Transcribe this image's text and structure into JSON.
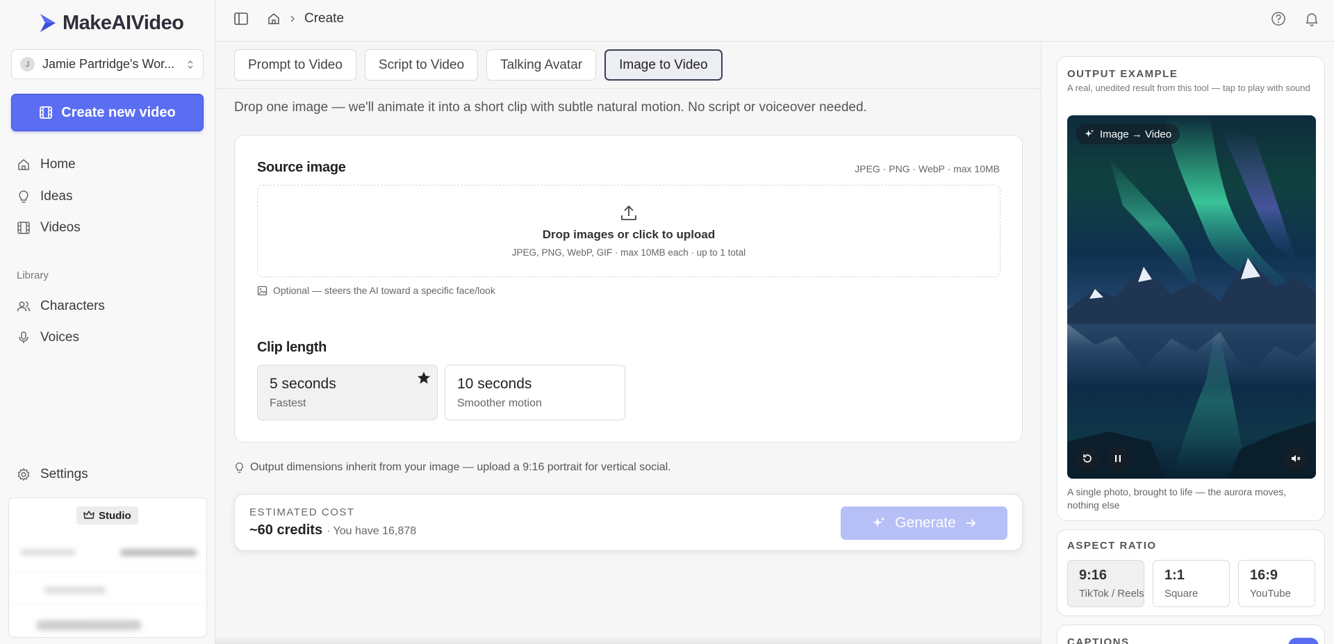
{
  "sidebar": {
    "logo_text": "MakeAIVideo",
    "workspace": {
      "initial": "J",
      "name": "Jamie Partridge's Wor..."
    },
    "create_button": "Create new video",
    "nav": [
      {
        "label": "Home",
        "icon": "home-icon"
      },
      {
        "label": "Ideas",
        "icon": "lightbulb-icon"
      },
      {
        "label": "Videos",
        "icon": "film-icon"
      }
    ],
    "library_label": "Library",
    "library": [
      {
        "label": "Characters",
        "icon": "users-icon"
      },
      {
        "label": "Voices",
        "icon": "microphone-icon"
      }
    ],
    "settings_label": "Settings",
    "plan": {
      "badge": "Studio"
    }
  },
  "topbar": {
    "breadcrumb_current": "Create"
  },
  "tabs": [
    {
      "label": "Prompt to Video",
      "active": false
    },
    {
      "label": "Script to Video",
      "active": false
    },
    {
      "label": "Talking Avatar",
      "active": false
    },
    {
      "label": "Image to Video",
      "active": true
    }
  ],
  "description": "Drop one image — we'll animate it into a short clip with subtle natural motion. No script or voiceover needed.",
  "source_image": {
    "title": "Source image",
    "formats": "JPEG · PNG · WebP · max 10MB",
    "drop_title": "Drop images or click to upload",
    "drop_sub": "JPEG, PNG, WebP, GIF · max 10MB each · up to 1 total",
    "hint": "Optional — steers the AI toward a specific face/look"
  },
  "clip_length": {
    "title": "Clip length",
    "options": [
      {
        "title": "5 seconds",
        "sub": "Fastest",
        "selected": true
      },
      {
        "title": "10 seconds",
        "sub": "Smoother motion",
        "selected": false
      }
    ]
  },
  "tip": "Output dimensions inherit from your image — upload a 9:16 portrait for vertical social.",
  "cost": {
    "label": "ESTIMATED COST",
    "value": "~60 credits",
    "have": "· You have 16,878",
    "generate": "Generate"
  },
  "output_example": {
    "label": "OUTPUT EXAMPLE",
    "sub": "A real, unedited result from this tool — tap to play with sound",
    "badge": "Image → Video",
    "caption": "A single photo, brought to life — the aurora moves, nothing else"
  },
  "aspect_ratio": {
    "label": "ASPECT RATIO",
    "options": [
      {
        "title": "9:16",
        "sub": "TikTok / Reels",
        "selected": true
      },
      {
        "title": "1:1",
        "sub": "Square",
        "selected": false
      },
      {
        "title": "16:9",
        "sub": "YouTube",
        "selected": false
      }
    ]
  },
  "captions": {
    "label": "CAPTIONS",
    "enabled": true
  },
  "colors": {
    "accent": "#5b6ef2",
    "generate_disabled": "#b7bff7"
  }
}
